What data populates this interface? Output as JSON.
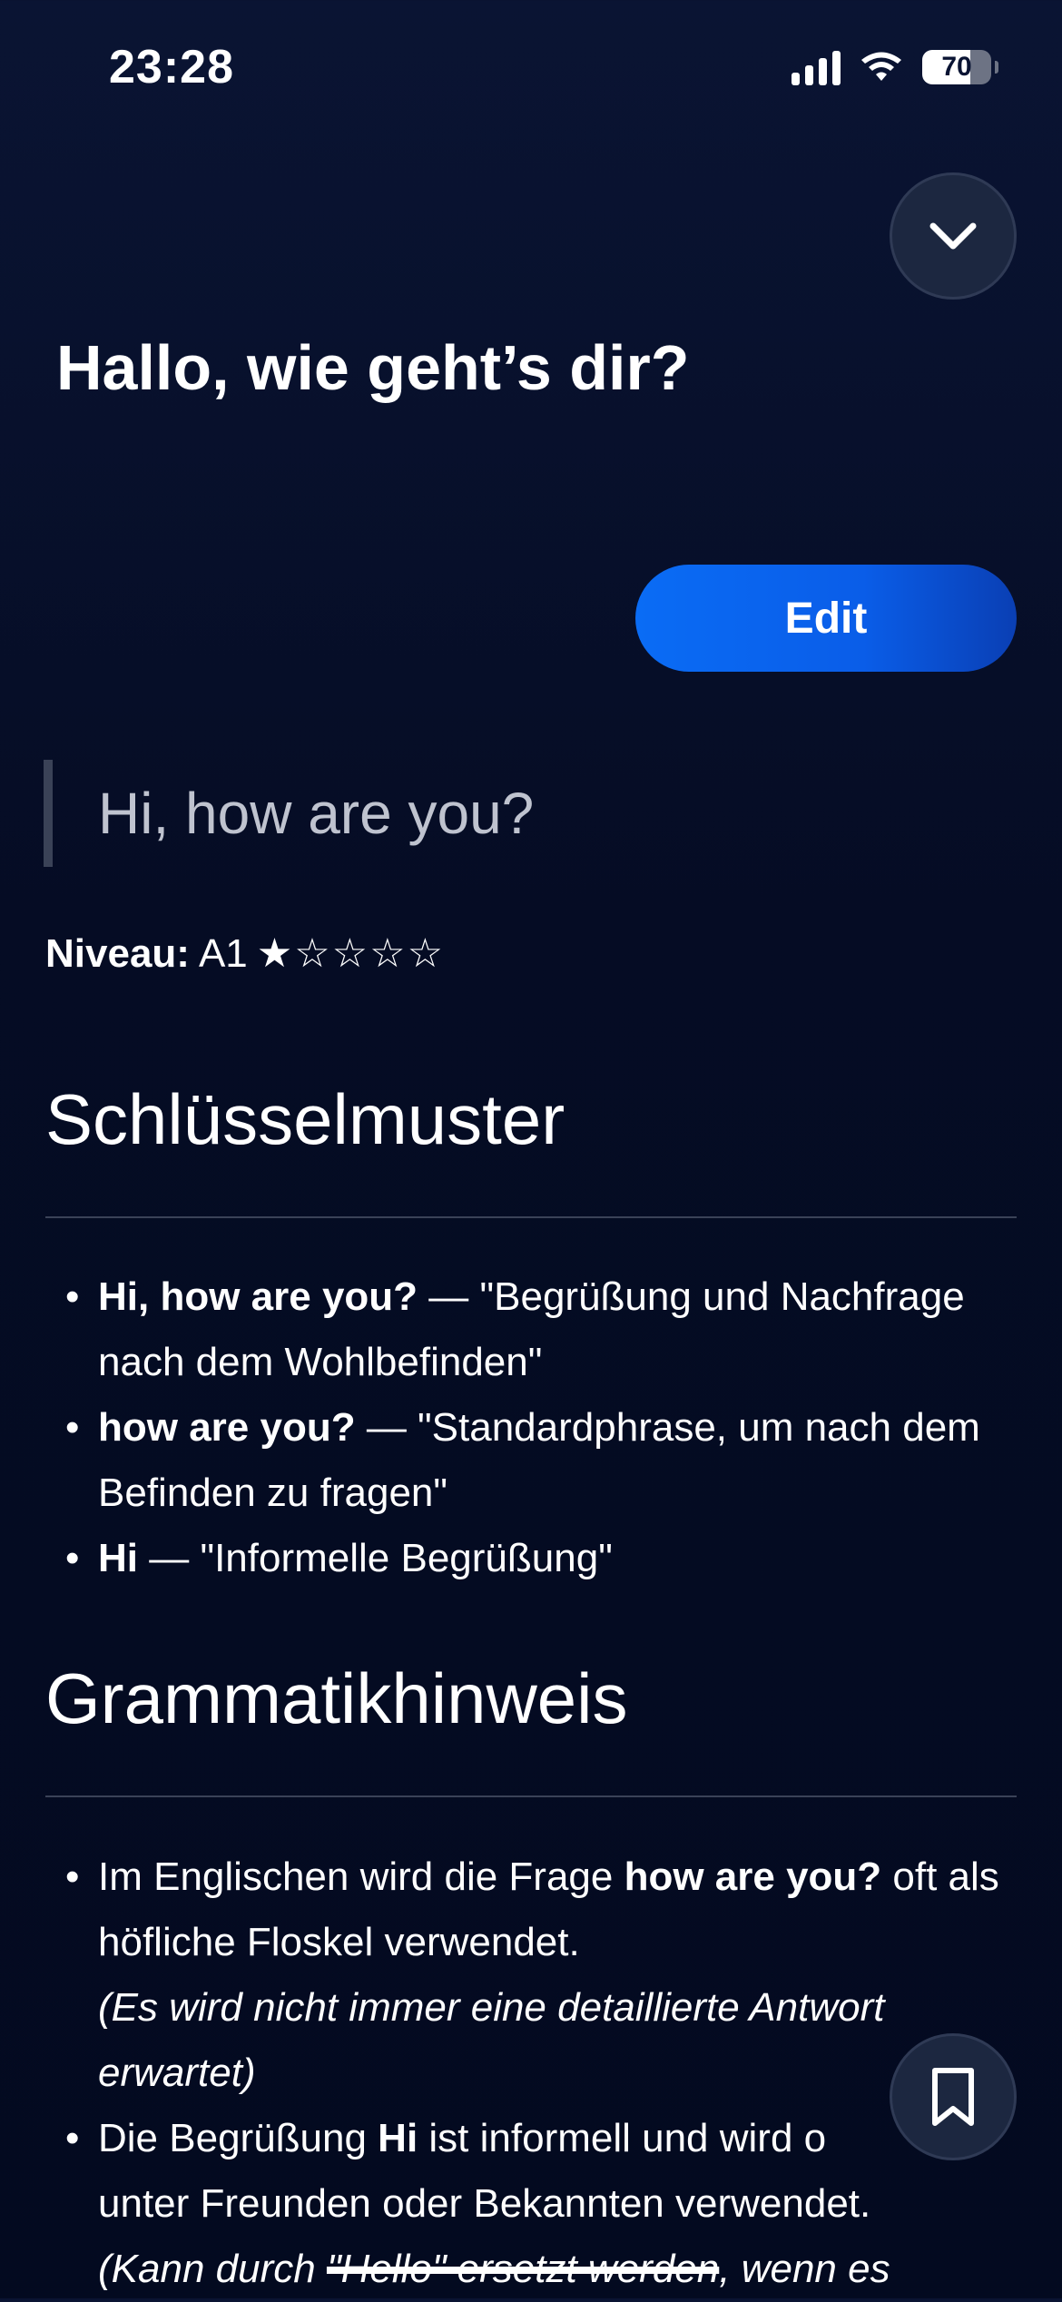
{
  "status_bar": {
    "time": "23:28",
    "battery": "70"
  },
  "header": {
    "title": "Hallo, wie geht’s dir?",
    "edit_label": "Edit"
  },
  "translation": "Hi, how are you?",
  "level": {
    "label": "Niveau:",
    "value": "A1",
    "stars": "★☆☆☆☆",
    "rating": 1,
    "max": 5
  },
  "sections": {
    "key_patterns": {
      "heading": "Schlüsselmuster",
      "items": [
        {
          "term": "Hi, how are you?",
          "explanation": "— \"Begrüßung und Nachfrage nach dem Wohlbefinden\""
        },
        {
          "term": "how are you?",
          "explanation": "— \"Standardphrase, um nach dem Befinden zu fragen\""
        },
        {
          "term": "Hi",
          "explanation": "— \"Informelle Begrüßung\""
        }
      ]
    },
    "grammar": {
      "heading": "Grammatikhinweis",
      "items": [
        {
          "before": "Im Englischen wird die Frage ",
          "term": "how are you?",
          "after": " oft als höfliche Floskel verwendet.",
          "note": "(Es wird nicht immer eine detaillierte Antwort erwartet)"
        },
        {
          "before": "Die Begrüßung ",
          "term": "Hi",
          "after": " ist informell und wird o",
          "line2": "unter Freunden oder Bekannten verwendet.",
          "note_start": "(Kann durch ",
          "note_strike": "\"Hello\" ersetzt werden",
          "note_end": ", wenn es"
        }
      ]
    }
  },
  "colors": {
    "background": "#050c24",
    "accent": "#0a6cf5",
    "muted_text": "#bfc3cf"
  }
}
